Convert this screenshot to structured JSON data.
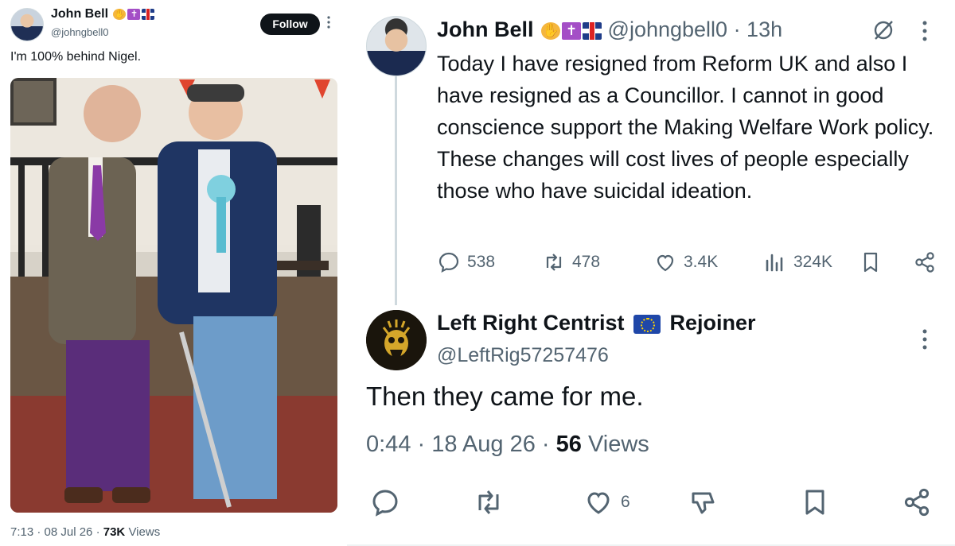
{
  "left_tweet": {
    "display_name": "John Bell",
    "badges": [
      "pray-emoji",
      "cross-emoji",
      "uk-flag-emoji"
    ],
    "handle": "@johngbell0",
    "follow_label": "Follow",
    "text": "I'm 100% behind Nigel.",
    "photo": "two-men-standing-photo",
    "meta_time": "7:13 · 08 Jul 26 ·",
    "meta_views_count": "73K",
    "meta_views_label": "Views"
  },
  "right_tweet": {
    "display_name": "John Bell",
    "badges": [
      "pray-emoji",
      "cross-emoji",
      "uk-flag-emoji"
    ],
    "handle_time": "@johngbell0 · 13h",
    "body": "Today I have resigned from Reform UK and also I have resigned as a Councillor.  I cannot in good conscience support the Making Welfare Work policy.  These changes will cost lives of people especially those who have suicidal ideation.",
    "replies": "538",
    "reposts": "478",
    "likes": "3.4K",
    "views": "324K"
  },
  "reply_tweet": {
    "display_name": "Left Right Centrist",
    "name_suffix": "Rejoiner",
    "flag_icon": "eu-flag-emoji",
    "handle": "@LeftRig57257476",
    "text": "Then they came for me.",
    "meta_time": "0:44 · 18 Aug 26 ·",
    "meta_views_count": "56",
    "meta_views_label": "Views",
    "likes": "6"
  },
  "colors": {
    "text": "#0f1419",
    "muted": "#536471",
    "border": "#cfd9de",
    "follow_bg": "#0f1419"
  }
}
